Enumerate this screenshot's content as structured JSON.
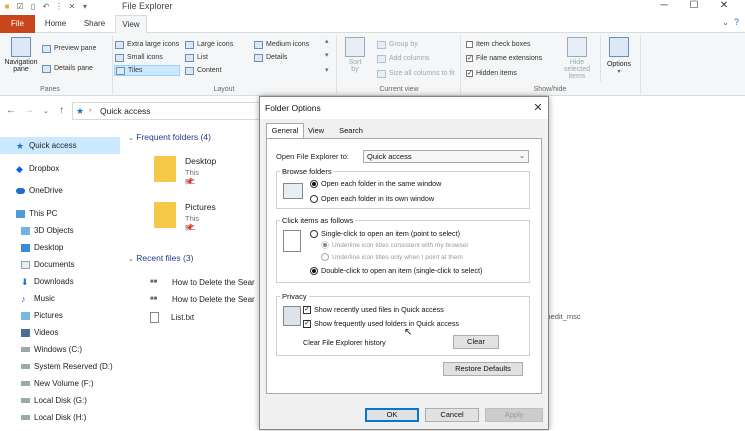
{
  "window": {
    "title": "File Explorer"
  },
  "ribbon_tabs": [
    "File",
    "Home",
    "Share",
    "View"
  ],
  "ribbon": {
    "panes": {
      "navigation_pane": "Navigation",
      "navigation_pane2": "pane",
      "preview_pane": "Preview pane",
      "details_pane": "Details pane",
      "label": "Panes"
    },
    "layout": {
      "items": [
        "Extra large icons",
        "Large icons",
        "Medium icons",
        "Small icons",
        "List",
        "Details",
        "Tiles",
        "Content"
      ],
      "label": "Layout"
    },
    "current_view": {
      "sort_by": "Sort",
      "sort_by2": "by",
      "group_by": "Group by",
      "add_columns": "Add columns",
      "size_all": "Size all columns to fit",
      "label": "Current view"
    },
    "show_hide": {
      "item_check_boxes": "Item check boxes",
      "file_name_extensions": "File name extensions",
      "hidden_items": "Hidden items",
      "hide_selected": "Hide selected",
      "hide_selected2": "items",
      "options": "Options",
      "label": "Show/hide"
    }
  },
  "address": {
    "path": "Quick access"
  },
  "nav": [
    {
      "label": "Quick access",
      "icon": "star-icon",
      "level": 0
    },
    {
      "label": "Dropbox",
      "icon": "dropbox-icon",
      "level": 0
    },
    {
      "label": "OneDrive",
      "icon": "cloud-icon",
      "level": 0
    },
    {
      "label": "This PC",
      "icon": "computer-icon",
      "level": 0
    },
    {
      "label": "3D Objects",
      "icon": "cube-icon",
      "level": 1
    },
    {
      "label": "Desktop",
      "icon": "desktop-icon",
      "level": 1
    },
    {
      "label": "Documents",
      "icon": "document-icon",
      "level": 1
    },
    {
      "label": "Downloads",
      "icon": "download-icon",
      "level": 1
    },
    {
      "label": "Music",
      "icon": "music-icon",
      "level": 1
    },
    {
      "label": "Pictures",
      "icon": "picture-icon",
      "level": 1
    },
    {
      "label": "Videos",
      "icon": "video-icon",
      "level": 1
    },
    {
      "label": "Windows (C:)",
      "icon": "drive-icon",
      "level": 1
    },
    {
      "label": "System Reserved (D:)",
      "icon": "drive-icon",
      "level": 1
    },
    {
      "label": "New Volume (F:)",
      "icon": "drive-icon",
      "level": 1
    },
    {
      "label": "Local Disk (G:)",
      "icon": "drive-icon",
      "level": 1
    },
    {
      "label": "Local Disk (H:)",
      "icon": "drive-icon",
      "level": 1
    }
  ],
  "content": {
    "frequent_header": "Frequent folders (4)",
    "folders": [
      {
        "name": "Desktop",
        "sub": "This PC"
      },
      {
        "name": "Pictures",
        "sub": "This PC"
      }
    ],
    "recent_header": "Recent files (3)",
    "recent": [
      "How to Delete the Sear",
      "How to Delete the Sear",
      "List.txt"
    ],
    "partial_text": "t_gpedit_msc"
  },
  "dialog": {
    "title": "Folder Options",
    "tabs": [
      "General",
      "View",
      "Search"
    ],
    "open_label": "Open File Explorer to:",
    "open_value": "Quick access",
    "browse_title": "Browse folders",
    "browse_same": "Open each folder in the same window",
    "browse_own": "Open each folder in its own window",
    "click_title": "Click items as follows",
    "single_click": "Single-click to open an item (point to select)",
    "underline_browser": "Underline icon titles consistent with my browser",
    "underline_point": "Underline icon titles only when I point at them",
    "double_click": "Double-click to open an item (single-click to select)",
    "privacy_title": "Privacy",
    "show_recent": "Show recently used files in Quick access",
    "show_frequent": "Show frequently used folders in Quick access",
    "clear_label": "Clear File Explorer history",
    "clear_btn": "Clear",
    "restore_btn": "Restore Defaults",
    "ok": "OK",
    "cancel": "Cancel",
    "apply": "Apply"
  }
}
